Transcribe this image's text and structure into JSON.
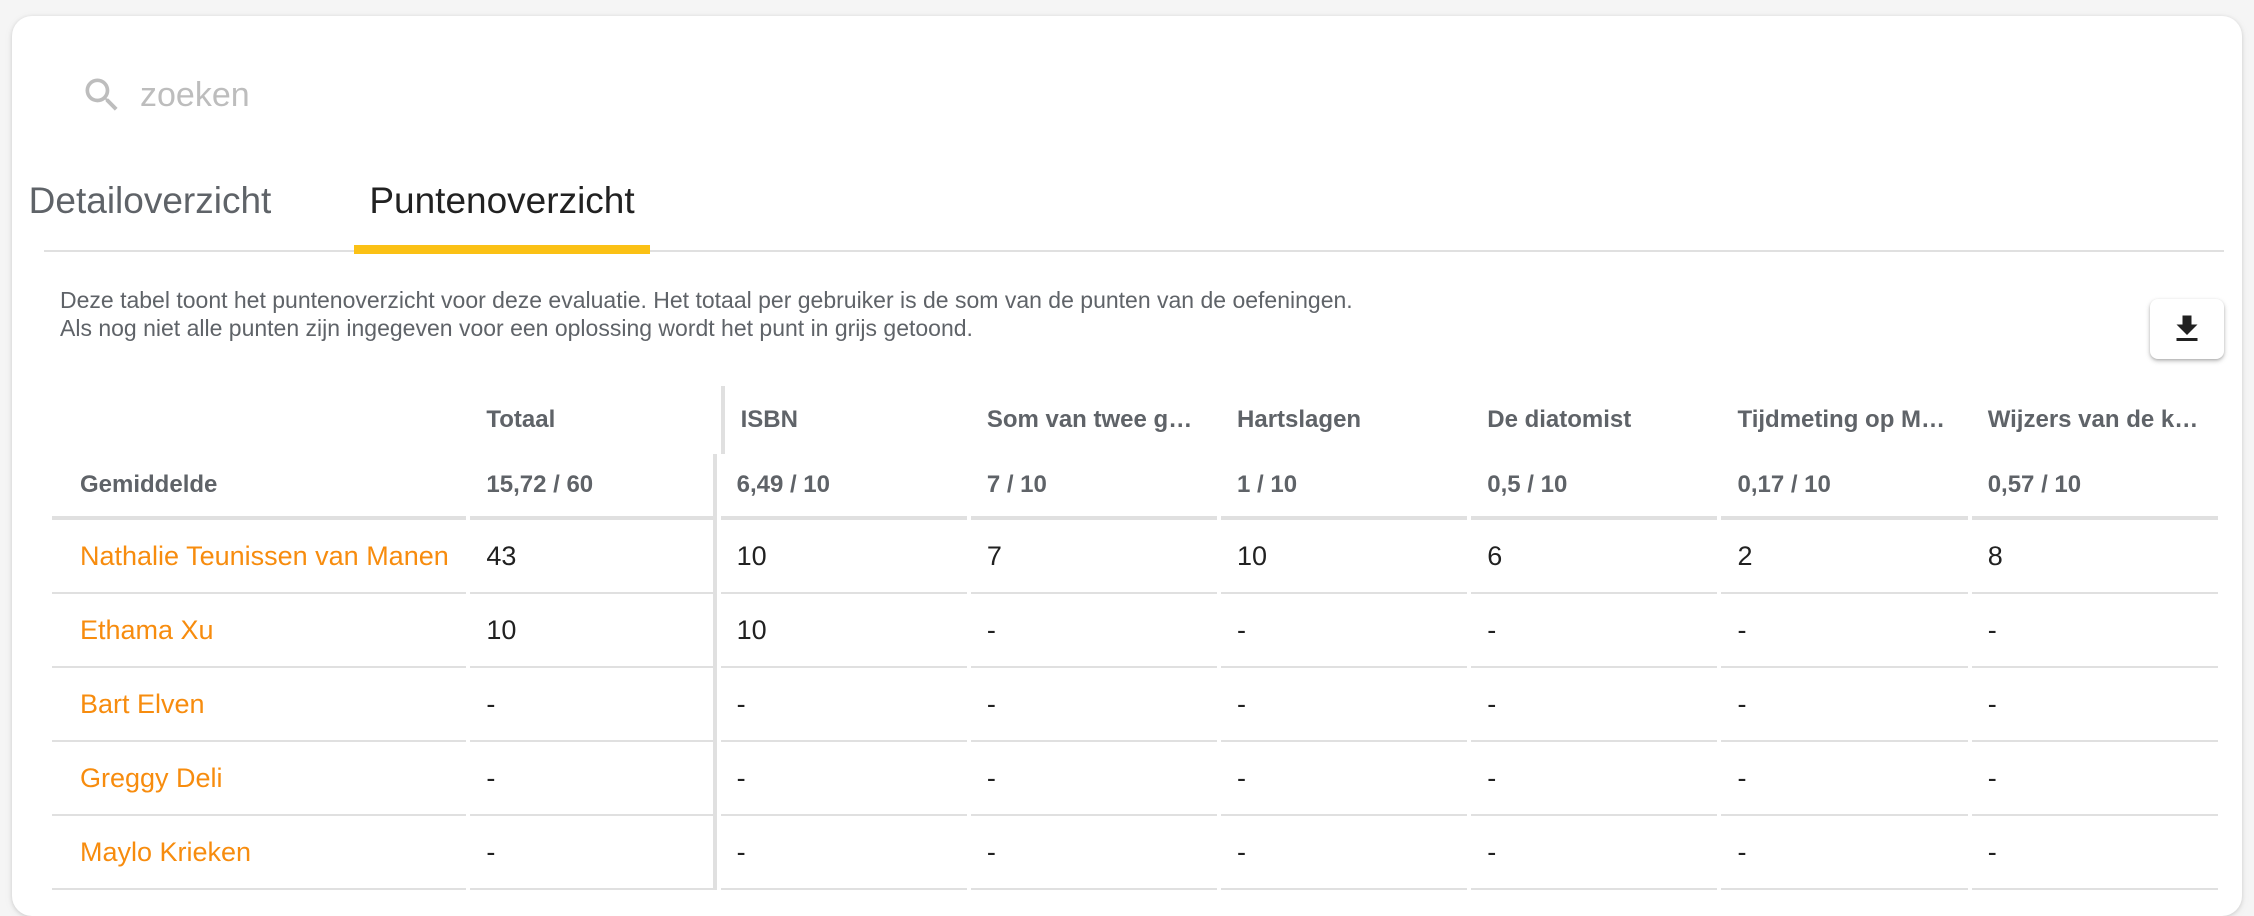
{
  "search": {
    "placeholder": "zoeken"
  },
  "tabs": [
    {
      "label": "Detailoverzicht",
      "active": false
    },
    {
      "label": "Puntenoverzicht",
      "active": true
    }
  ],
  "description": {
    "line1": "Deze tabel toont het puntenoverzicht voor deze evaluatie. Het totaal per gebruiker is de som van de punten van de oefeningen.",
    "line2": "Als nog niet alle punten zijn ingegeven voor een oplossing wordt het punt in grijs getoond."
  },
  "download": {
    "icon": "download-icon"
  },
  "table": {
    "total_header": "Totaal",
    "exercises": [
      "ISBN",
      "Som van twee get...",
      "Hartslagen",
      "De diatomist",
      "Tijdmeting op Mars",
      "Wijzers van de klok"
    ],
    "average": {
      "label": "Gemiddelde",
      "total": "15,72 / 60",
      "scores": [
        "6,49 / 10",
        "7 / 10",
        "1 / 10",
        "0,5 / 10",
        "0,17 / 10",
        "0,57 / 10"
      ]
    },
    "rows": [
      {
        "name": "Nathalie Teunissen van Manen",
        "total": "43",
        "scores": [
          "10",
          "7",
          "10",
          "6",
          "2",
          "8"
        ]
      },
      {
        "name": "Ethama Xu",
        "total": "10",
        "scores": [
          "10",
          "-",
          "-",
          "-",
          "-",
          "-"
        ]
      },
      {
        "name": "Bart Elven",
        "total": "-",
        "scores": [
          "-",
          "-",
          "-",
          "-",
          "-",
          "-"
        ]
      },
      {
        "name": "Greggy Deli",
        "total": "-",
        "scores": [
          "-",
          "-",
          "-",
          "-",
          "-",
          "-"
        ]
      },
      {
        "name": "Maylo Krieken",
        "total": "-",
        "scores": [
          "-",
          "-",
          "-",
          "-",
          "-",
          "-"
        ]
      }
    ]
  },
  "colors": {
    "accent": "#fbc115",
    "link": "#f78c0e",
    "muted": "#5f6368"
  }
}
